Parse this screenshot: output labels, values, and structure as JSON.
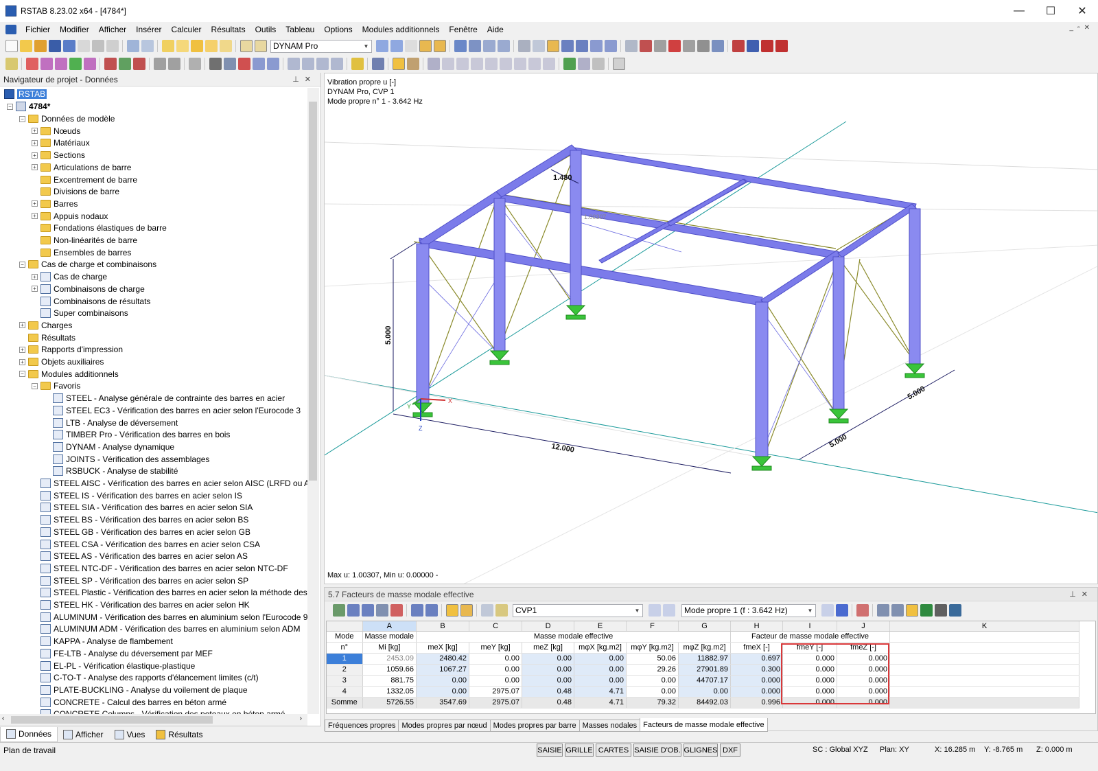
{
  "window": {
    "title": "RSTAB 8.23.02 x64 - [4784*]",
    "minimize": "—",
    "maximize": "☐",
    "close": "✕"
  },
  "menu": [
    "Fichier",
    "Modifier",
    "Afficher",
    "Insérer",
    "Calculer",
    "Résultats",
    "Outils",
    "Tableau",
    "Options",
    "Modules additionnels",
    "Fenêtre",
    "Aide"
  ],
  "toolbar": {
    "module_combo": "DYNAM Pro"
  },
  "navigator": {
    "title": "Navigateur de projet - Données",
    "root": "RSTAB",
    "project": "4784*",
    "items": [
      {
        "label": "Données de modèle",
        "level": 1,
        "exp": "−",
        "icon": "folder"
      },
      {
        "label": "Nœuds",
        "level": 2,
        "exp": "+",
        "icon": "folder"
      },
      {
        "label": "Matériaux",
        "level": 2,
        "exp": "+",
        "icon": "folder"
      },
      {
        "label": "Sections",
        "level": 2,
        "exp": "+",
        "icon": "folder"
      },
      {
        "label": "Articulations de barre",
        "level": 2,
        "exp": "+",
        "icon": "folder"
      },
      {
        "label": "Excentrement de barre",
        "level": 2,
        "exp": "",
        "icon": "folder"
      },
      {
        "label": "Divisions de barre",
        "level": 2,
        "exp": "",
        "icon": "folder"
      },
      {
        "label": "Barres",
        "level": 2,
        "exp": "+",
        "icon": "folder"
      },
      {
        "label": "Appuis nodaux",
        "level": 2,
        "exp": "+",
        "icon": "folder"
      },
      {
        "label": "Fondations élastiques de barre",
        "level": 2,
        "exp": "",
        "icon": "folder"
      },
      {
        "label": "Non-linéarités de barre",
        "level": 2,
        "exp": "",
        "icon": "folder"
      },
      {
        "label": "Ensembles de barres",
        "level": 2,
        "exp": "",
        "icon": "folder"
      },
      {
        "label": "Cas de charge et combinaisons",
        "level": 1,
        "exp": "−",
        "icon": "folder"
      },
      {
        "label": "Cas de charge",
        "level": 2,
        "exp": "+",
        "icon": "module"
      },
      {
        "label": "Combinaisons de charge",
        "level": 2,
        "exp": "+",
        "icon": "module"
      },
      {
        "label": "Combinaisons de résultats",
        "level": 2,
        "exp": "",
        "icon": "module"
      },
      {
        "label": "Super combinaisons",
        "level": 2,
        "exp": "",
        "icon": "module"
      },
      {
        "label": "Charges",
        "level": 1,
        "exp": "+",
        "icon": "folder"
      },
      {
        "label": "Résultats",
        "level": 1,
        "exp": "",
        "icon": "folder"
      },
      {
        "label": "Rapports d'impression",
        "level": 1,
        "exp": "+",
        "icon": "folder"
      },
      {
        "label": "Objets auxiliaires",
        "level": 1,
        "exp": "+",
        "icon": "folder"
      },
      {
        "label": "Modules additionnels",
        "level": 1,
        "exp": "−",
        "icon": "folder"
      },
      {
        "label": "Favoris",
        "level": 2,
        "exp": "−",
        "icon": "folder"
      },
      {
        "label": "STEEL - Analyse générale de contrainte des barres en acier",
        "level": 3,
        "exp": "",
        "icon": "module"
      },
      {
        "label": "STEEL EC3 - Vérification des barres en acier selon l'Eurocode 3",
        "level": 3,
        "exp": "",
        "icon": "module"
      },
      {
        "label": "LTB - Analyse de déversement",
        "level": 3,
        "exp": "",
        "icon": "module"
      },
      {
        "label": "TIMBER Pro - Vérification des barres en bois",
        "level": 3,
        "exp": "",
        "icon": "module"
      },
      {
        "label": "DYNAM - Analyse dynamique",
        "level": 3,
        "exp": "",
        "icon": "module"
      },
      {
        "label": "JOINTS - Vérification des assemblages",
        "level": 3,
        "exp": "",
        "icon": "module"
      },
      {
        "label": "RSBUCK - Analyse de stabilité",
        "level": 3,
        "exp": "",
        "icon": "module"
      },
      {
        "label": "STEEL AISC - Vérification des barres en acier selon AISC (LRFD ou ASD)",
        "level": 2,
        "exp": "",
        "icon": "module"
      },
      {
        "label": "STEEL IS - Vérification des barres en acier selon IS",
        "level": 2,
        "exp": "",
        "icon": "module"
      },
      {
        "label": "STEEL SIA - Vérification des barres en acier selon SIA",
        "level": 2,
        "exp": "",
        "icon": "module"
      },
      {
        "label": "STEEL BS - Vérification des barres en acier selon BS",
        "level": 2,
        "exp": "",
        "icon": "module"
      },
      {
        "label": "STEEL GB - Vérification des barres en acier selon GB",
        "level": 2,
        "exp": "",
        "icon": "module"
      },
      {
        "label": "STEEL CSA - Vérification des barres en acier selon CSA",
        "level": 2,
        "exp": "",
        "icon": "module"
      },
      {
        "label": "STEEL AS - Vérification des barres en acier selon AS",
        "level": 2,
        "exp": "",
        "icon": "module"
      },
      {
        "label": "STEEL NTC-DF - Vérification des barres en acier selon NTC-DF",
        "level": 2,
        "exp": "",
        "icon": "module"
      },
      {
        "label": "STEEL SP - Vérification des barres en acier selon SP",
        "level": 2,
        "exp": "",
        "icon": "module"
      },
      {
        "label": "STEEL Plastic - Vérification des barres en acier selon la méthode des élé",
        "level": 2,
        "exp": "",
        "icon": "module"
      },
      {
        "label": "STEEL HK - Vérification des barres en acier selon HK",
        "level": 2,
        "exp": "",
        "icon": "module"
      },
      {
        "label": "ALUMINUM - Vérification des barres en aluminium selon l'Eurocode 9",
        "level": 2,
        "exp": "",
        "icon": "module"
      },
      {
        "label": "ALUMINUM ADM - Vérification des barres en aluminium selon ADM",
        "level": 2,
        "exp": "",
        "icon": "module"
      },
      {
        "label": "KAPPA - Analyse de flambement",
        "level": 2,
        "exp": "",
        "icon": "module"
      },
      {
        "label": "FE-LTB - Analyse du déversement par MEF",
        "level": 2,
        "exp": "",
        "icon": "module"
      },
      {
        "label": "EL-PL - Vérification élastique-plastique",
        "level": 2,
        "exp": "",
        "icon": "module"
      },
      {
        "label": "C-TO-T - Analyse des rapports d'élancement limites (c/t)",
        "level": 2,
        "exp": "",
        "icon": "module"
      },
      {
        "label": "PLATE-BUCKLING - Analyse du voilement de plaque",
        "level": 2,
        "exp": "",
        "icon": "module"
      },
      {
        "label": "CONCRETE - Calcul des barres en béton armé",
        "level": 2,
        "exp": "",
        "icon": "module"
      },
      {
        "label": "CONCRETE Columns - Vérification des poteaux en béton armé",
        "level": 2,
        "exp": "",
        "icon": "module"
      }
    ],
    "tabs": [
      "Données",
      "Afficher",
      "Vues",
      "Résultats"
    ]
  },
  "viewport": {
    "info": [
      "Vibration propre u [-]",
      "DYNAM Pro, CVP 1",
      "Mode propre n° 1 - 3.642 Hz"
    ],
    "footer": "Max u: 1.00307, Min u: 0.00000 -",
    "dims": {
      "height": "5.000",
      "top": "1.480",
      "length": "12.000",
      "w1": "5.000",
      "w2": "5.000",
      "max_label": "1.00307"
    },
    "axes": {
      "x": "X",
      "y": "Y",
      "z": "Z"
    }
  },
  "table_panel": {
    "title": "5.7 Facteurs de masse modale effective",
    "case_combo": "CVP1",
    "mode_combo": "Mode propre 1 (f : 3.642 Hz)",
    "col_letters": [
      "A",
      "B",
      "C",
      "D",
      "E",
      "F",
      "G",
      "H",
      "I",
      "J",
      "K"
    ],
    "group1": "Masse modale effective",
    "group2": "Facteur de masse modale effective",
    "mode_head": [
      "Mode",
      "n°"
    ],
    "mass_head": [
      "Masse modale",
      "Mi [kg]"
    ],
    "sub_heads": [
      "meX [kg]",
      "meY [kg]",
      "meZ [kg]",
      "mφX [kg.m2]",
      "mφY [kg.m2]",
      "mφZ [kg.m2]",
      "fmeX [-]",
      "fmeY [-]",
      "fmeZ [-]"
    ],
    "rows": [
      {
        "n": "1",
        "cells": [
          "2453.09",
          "2480.42",
          "0.00",
          "0.00",
          "0.00",
          "50.06",
          "11882.97",
          "0.697",
          "0.000",
          "0.000"
        ]
      },
      {
        "n": "2",
        "cells": [
          "1059.66",
          "1067.27",
          "0.00",
          "0.00",
          "0.00",
          "29.26",
          "27901.89",
          "0.300",
          "0.000",
          "0.000"
        ]
      },
      {
        "n": "3",
        "cells": [
          "881.75",
          "0.00",
          "0.00",
          "0.00",
          "0.00",
          "0.00",
          "44707.17",
          "0.000",
          "0.000",
          "0.000"
        ]
      },
      {
        "n": "4",
        "cells": [
          "1332.05",
          "0.00",
          "2975.07",
          "0.48",
          "4.71",
          "0.00",
          "0.00",
          "0.000",
          "0.000",
          "0.000"
        ]
      },
      {
        "n": "Somme",
        "cells": [
          "5726.55",
          "3547.69",
          "2975.07",
          "0.48",
          "4.71",
          "79.32",
          "84492.03",
          "0.996",
          "0.000",
          "0.000"
        ]
      }
    ],
    "tabs": [
      "Fréquences propres",
      "Modes propres par nœud",
      "Modes propres par barre",
      "Masses nodales",
      "Facteurs de masse modale effective"
    ]
  },
  "status": {
    "left": "Plan de travail",
    "buttons": [
      "SAISIE",
      "GRILLE",
      "CARTES",
      "SAISIE D'OB.",
      "GLIGNES",
      "DXF"
    ],
    "sc": "SC : Global XYZ",
    "plane": "Plan: XY",
    "x": "X:  16.285 m",
    "y": "Y:  -8.765 m",
    "z": "Z:  0.000 m"
  },
  "colors": {
    "member": "#7b7bea",
    "member_edge": "#5050c8",
    "brace": "#8a8a2a",
    "support": "#3ac43a",
    "grid_line": "#1a9a9a",
    "selection_blue": "#3c7fd9",
    "highlight_red": "#d9383a"
  }
}
